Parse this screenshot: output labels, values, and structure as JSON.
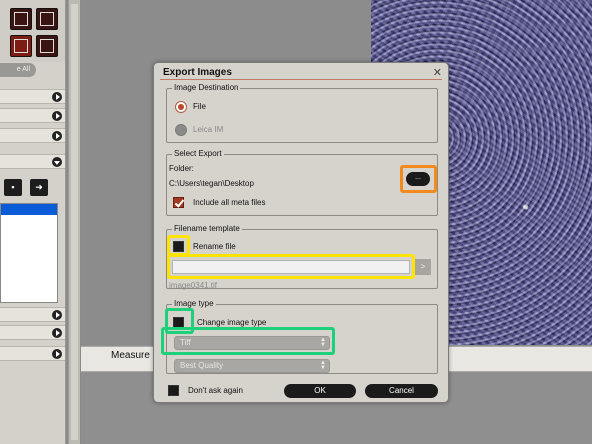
{
  "background": {
    "left_panel_button": "e All",
    "bottom_tab": "Measure"
  },
  "dialog": {
    "title": "Export Images",
    "close_glyph": "✕",
    "image_destination": {
      "label": "Image Destination",
      "options": [
        "File",
        "Leica IM"
      ],
      "selected": "File"
    },
    "select_export": {
      "label": "Select Export",
      "folder_label": "Folder:",
      "folder_path": "C:\\Users\\tegan\\Desktop",
      "browse_label": "...",
      "include_meta_label": "Include all meta files",
      "include_meta_checked": true
    },
    "filename_template": {
      "label": "Filename template",
      "rename_label": "Rename file",
      "rename_checked": false,
      "input_value": "",
      "arrow_label": ">",
      "example_name": "image0341.tif"
    },
    "image_type": {
      "label": "Image type",
      "change_label": "Change image type",
      "change_checked": false,
      "format_value": "Tiff",
      "quality_value": "Best Quality"
    },
    "dont_ask_label": "Don't ask again",
    "dont_ask_checked": false,
    "ok_label": "OK",
    "cancel_label": "Cancel"
  },
  "colors": {
    "highlight_orange": "#f28a1e",
    "highlight_yellow": "#ffe400",
    "highlight_green": "#1fd07a",
    "radio_accent": "#b84a2a"
  }
}
